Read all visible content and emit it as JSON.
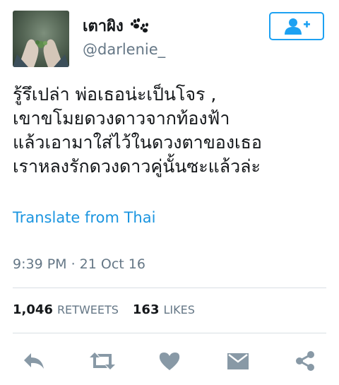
{
  "tweet": {
    "author": {
      "display_name": "เตาผิง",
      "handle": "@darlenie_",
      "name_emoji_icon": "paw-prints-icon",
      "avatar_icon": "hands-holding-leaves-photo"
    },
    "follow_icon": "add-user-icon",
    "text_lines": [
      "รู้รึเปล่า พ่อเธอน่ะเป็นโจร ,",
      "เขาขโมยดวงดาวจากท้องฟ้า",
      "แล้วเอามาใส่ไว้ในดวงตาของเธอ",
      "เราหลงรักดวงดาวคู่นั้นซะแล้วล่ะ"
    ],
    "translate_label": "Translate from Thai",
    "timestamp": "9:39 PM · 21 Oct 16",
    "stats": {
      "retweets_count": "1,046",
      "retweets_label": "RETWEETS",
      "likes_count": "163",
      "likes_label": "LIKES"
    },
    "actions": [
      "reply-icon",
      "retweet-icon",
      "like-icon",
      "direct-message-icon",
      "share-icon"
    ]
  },
  "colors": {
    "accent": "#1da1f2",
    "link": "#1b95e0",
    "text": "#14171a",
    "secondary_text": "#657786",
    "icon_gray": "#8899a6",
    "divider": "#d8dfe4"
  }
}
